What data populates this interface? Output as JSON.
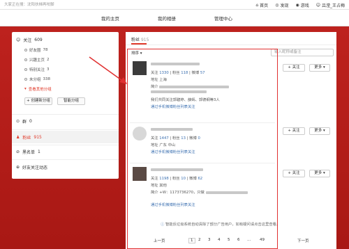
{
  "topbar": {
    "search_placeholder": "大家正在搜：沈阳扶梯再咬脚",
    "nav": [
      "首页",
      "发现",
      "游戏",
      "吕滢_王占梅"
    ]
  },
  "subnav": {
    "links": [
      "我的主页",
      "我的相册",
      "管理中心"
    ]
  },
  "sidebar": {
    "follow_label": "关注",
    "follow_count": "609",
    "groups": [
      {
        "label": "好友圈",
        "count": "78"
      },
      {
        "label": "兴趣主页",
        "count": "2"
      },
      {
        "label": "特别关注",
        "count": "3"
      },
      {
        "label": "未分组",
        "count": "338"
      }
    ],
    "view_all": "查看其他分组",
    "create_group": "创建新分组",
    "smart_group": "智能分组",
    "group_label": "群",
    "group_count": "0",
    "fans_label": "粉丝",
    "fans_count": "915",
    "blacklist_label": "黑名单",
    "blacklist_count": "1",
    "friend_activity": "好友关注动态"
  },
  "main": {
    "tab": "粉丝",
    "tab_count": "915",
    "sort_label": "排序 ▾",
    "search_placeholder": "输入昵称或备注",
    "items": [
      {
        "follow": "1330",
        "fans": "118",
        "weibo": "57",
        "addr": "上海",
        "extra1": "我们共同关注郭碧婷、薛嫣、郭德纲等3人",
        "via": "通过手机微博粉丝列表关注"
      },
      {
        "follow": "1447",
        "fans": "13",
        "weibo": "0",
        "addr": "广东 中山",
        "via": "通过手机微博粉丝列表关注"
      },
      {
        "follow": "1198",
        "fans": "10",
        "weibo": "62",
        "addr": "其他",
        "via": "通过手机微博粉丝列表关注",
        "intro": "简介 +W：1173736270，只做"
      }
    ],
    "labels": {
      "follow": "关注",
      "fans": "粉丝",
      "weibo": "微博",
      "addr_prefix": "地址",
      "intro_prefix": "简介",
      "follow_btn": "+ 关注",
      "more_btn": "更多"
    },
    "notice": "智能反垃圾系统自动清除了部分广告用户，如有疑问请点击这里查看。",
    "pager": {
      "prev": "上一页",
      "pages": [
        "1",
        "2",
        "3",
        "4",
        "5",
        "6",
        "...",
        "49"
      ],
      "next": "下一页"
    }
  }
}
